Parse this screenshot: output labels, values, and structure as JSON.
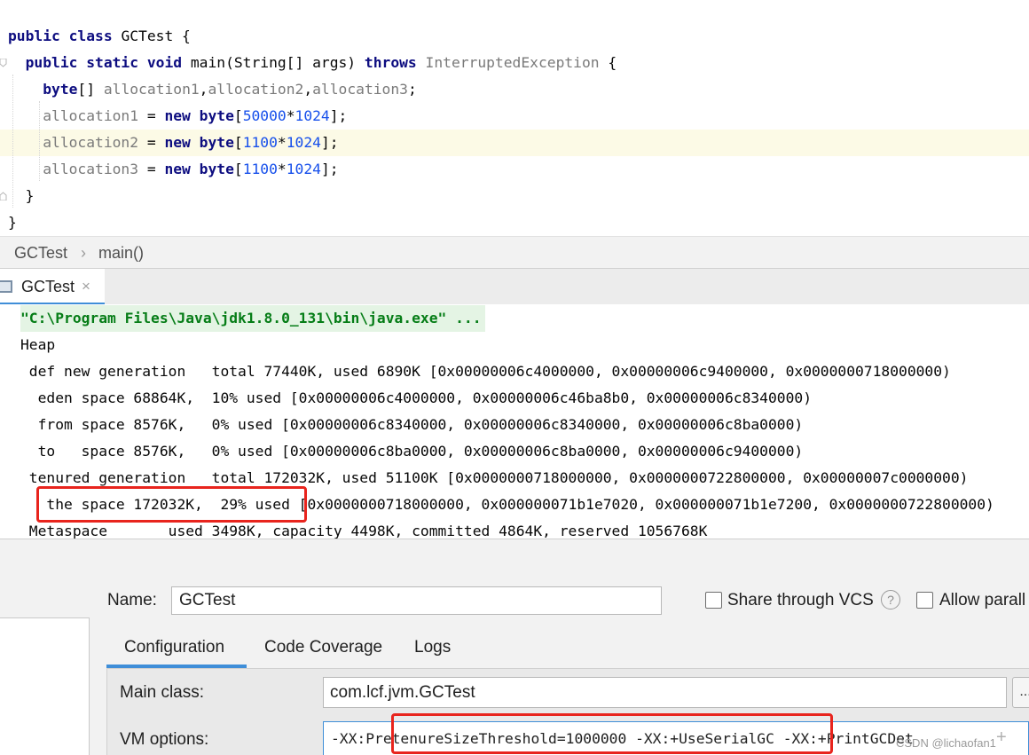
{
  "editor": {
    "lines": [
      [
        {
          "t": "public class ",
          "c": "kw"
        },
        {
          "t": "GCTest {",
          "c": "plain"
        }
      ],
      [
        {
          "t": "  public static void ",
          "c": "kw"
        },
        {
          "t": "main(String[] args) ",
          "c": "plain"
        },
        {
          "t": "throws ",
          "c": "kw"
        },
        {
          "t": "InterruptedException ",
          "c": "gray"
        },
        {
          "t": "{",
          "c": "plain"
        }
      ],
      [
        {
          "t": "    byte",
          "c": "kw"
        },
        {
          "t": "[] ",
          "c": "plain"
        },
        {
          "t": "allocation1",
          "c": "gray"
        },
        {
          "t": ",",
          "c": "plain"
        },
        {
          "t": "allocation2",
          "c": "gray"
        },
        {
          "t": ",",
          "c": "plain"
        },
        {
          "t": "allocation3",
          "c": "gray"
        },
        {
          "t": ";",
          "c": "plain"
        }
      ],
      [
        {
          "t": "    allocation1 ",
          "c": "gray"
        },
        {
          "t": "= ",
          "c": "plain"
        },
        {
          "t": "new byte",
          "c": "kw"
        },
        {
          "t": "[",
          "c": "plain"
        },
        {
          "t": "50000",
          "c": "num"
        },
        {
          "t": "*",
          "c": "plain"
        },
        {
          "t": "1024",
          "c": "num"
        },
        {
          "t": "];",
          "c": "plain"
        }
      ],
      [
        {
          "t": "    allocation2 ",
          "c": "gray"
        },
        {
          "t": "= ",
          "c": "plain"
        },
        {
          "t": "new byte",
          "c": "kw"
        },
        {
          "t": "[",
          "c": "plain"
        },
        {
          "t": "1100",
          "c": "num"
        },
        {
          "t": "*",
          "c": "plain"
        },
        {
          "t": "1024",
          "c": "num"
        },
        {
          "t": "];",
          "c": "plain"
        }
      ],
      [
        {
          "t": "    allocation3 ",
          "c": "gray"
        },
        {
          "t": "= ",
          "c": "plain"
        },
        {
          "t": "new byte",
          "c": "kw"
        },
        {
          "t": "[",
          "c": "plain"
        },
        {
          "t": "1100",
          "c": "num"
        },
        {
          "t": "*",
          "c": "plain"
        },
        {
          "t": "1024",
          "c": "num"
        },
        {
          "t": "];",
          "c": "plain"
        }
      ],
      [
        {
          "t": "  }",
          "c": "plain"
        }
      ],
      [
        {
          "t": "}",
          "c": "plain"
        }
      ]
    ]
  },
  "breadcrumb": {
    "class_name": "GCTest",
    "separator": "›",
    "method": "main()"
  },
  "run_panel": {
    "tab_title": "GCTest",
    "tab_close": "×",
    "command": "\"C:\\Program Files\\Java\\jdk1.8.0_131\\bin\\java.exe\" ...",
    "output": [
      "Heap",
      " def new generation   total 77440K, used 6890K [0x00000006c4000000, 0x00000006c9400000, 0x0000000718000000)",
      "  eden space 68864K,  10% used [0x00000006c4000000, 0x00000006c46ba8b0, 0x00000006c8340000)",
      "  from space 8576K,   0% used [0x00000006c8340000, 0x00000006c8340000, 0x00000006c8ba0000)",
      "  to   space 8576K,   0% used [0x00000006c8ba0000, 0x00000006c8ba0000, 0x00000006c9400000)",
      " tenured generation   total 172032K, used 51100K [0x0000000718000000, 0x0000000722800000, 0x00000007c0000000)",
      "   the space 172032K,  29% used [0x0000000718000000, 0x000000071b1e7020, 0x000000071b1e7200, 0x0000000722800000)",
      " Metaspace       used 3498K, capacity 4498K, committed 4864K, reserved 1056768K"
    ]
  },
  "dialog": {
    "name_label": "Name:",
    "name_value": "GCTest",
    "share_vcs_label": "Share through VCS",
    "help_glyph": "?",
    "allow_parallel_label": "Allow parall",
    "tabs": [
      "Configuration",
      "Code Coverage",
      "Logs"
    ],
    "main_class_label": "Main class:",
    "main_class_value": "com.lcf.jvm.GCTest",
    "browse_label": "...",
    "vm_options_label": "VM options:",
    "vm_options_value": "-XX:PretenureSizeThreshold=1000000 -XX:+UseSerialGC -XX:+PrintGCDet",
    "expand_glyph": "+",
    "watermark": "CSDN @lichaofan1"
  }
}
